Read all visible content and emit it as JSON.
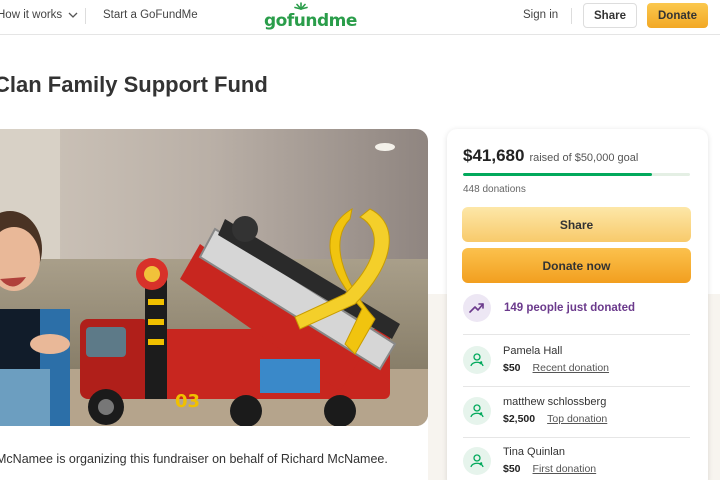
{
  "header": {
    "how_it_works": "How it works",
    "start_link": "Start a GoFundMe",
    "logo": "gofundme",
    "sign_in": "Sign in",
    "share_label": "Share",
    "donate_label": "Donate"
  },
  "page": {
    "title": "Clan Family Support Fund",
    "organizer_text": "McNamee is organizing this fundraiser on behalf of Richard McNamee."
  },
  "card": {
    "raised_amount": "$41,680",
    "raised_goal": "raised of $50,000 goal",
    "progress_fraction": 0.8336,
    "donation_count": "448 donations",
    "share_label": "Share",
    "donate_now_label": "Donate now",
    "trend_text": "149 people just donated",
    "donors": [
      {
        "name": "Pamela Hall",
        "amount": "$50",
        "tag": "Recent donation"
      },
      {
        "name": "matthew schlossberg",
        "amount": "$2,500",
        "tag": "Top donation"
      },
      {
        "name": "Tina Quinlan",
        "amount": "$50",
        "tag": "First donation"
      }
    ]
  },
  "colors": {
    "brand_green": "#02a95c",
    "donate_orange": "#f6b93b",
    "trend_purple": "#6b3a8c"
  },
  "icons": {
    "nav_chevron": "chevron-down-icon",
    "trend": "trending-up-icon",
    "donor": "donor-heart-icon"
  }
}
